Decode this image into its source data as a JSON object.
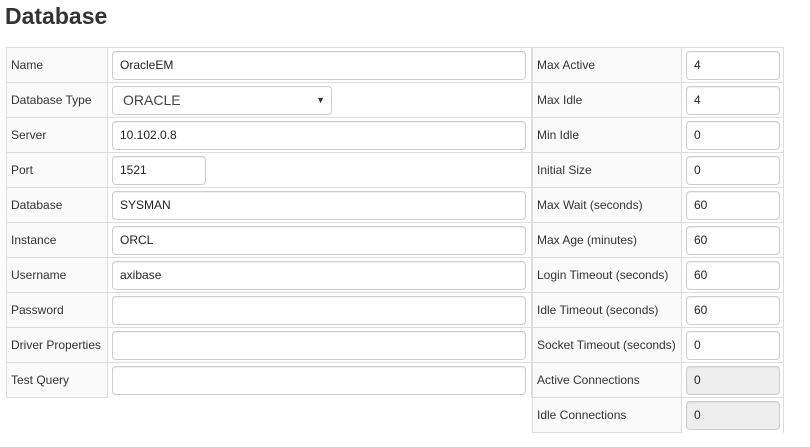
{
  "page": {
    "title": "Database"
  },
  "left_panel": {
    "fields": [
      {
        "label": "Name",
        "value": "OracleEM"
      },
      {
        "label": "Database Type",
        "value": "ORACLE"
      },
      {
        "label": "Server",
        "value": "10.102.0.8"
      },
      {
        "label": "Port",
        "value": "1521"
      },
      {
        "label": "Database",
        "value": "SYSMAN"
      },
      {
        "label": "Instance",
        "value": "ORCL"
      },
      {
        "label": "Username",
        "value": "axibase"
      },
      {
        "label": "Password",
        "value": ""
      },
      {
        "label": "Driver Properties",
        "value": ""
      },
      {
        "label": "Test Query",
        "value": ""
      }
    ]
  },
  "right_panel": {
    "fields": [
      {
        "label": "Max Active",
        "value": "4"
      },
      {
        "label": "Max Idle",
        "value": "4"
      },
      {
        "label": "Min Idle",
        "value": "0"
      },
      {
        "label": "Initial Size",
        "value": "0"
      },
      {
        "label": "Max Wait (seconds)",
        "value": "60"
      },
      {
        "label": "Max Age (minutes)",
        "value": "60"
      },
      {
        "label": "Login Timeout (seconds)",
        "value": "60"
      },
      {
        "label": "Idle Timeout (seconds)",
        "value": "60"
      },
      {
        "label": "Socket Timeout (seconds)",
        "value": "0"
      },
      {
        "label": "Active Connections",
        "value": "0"
      },
      {
        "label": "Idle Connections",
        "value": "0"
      }
    ]
  },
  "icons": {
    "select_caret": "chevron-down-icon"
  }
}
